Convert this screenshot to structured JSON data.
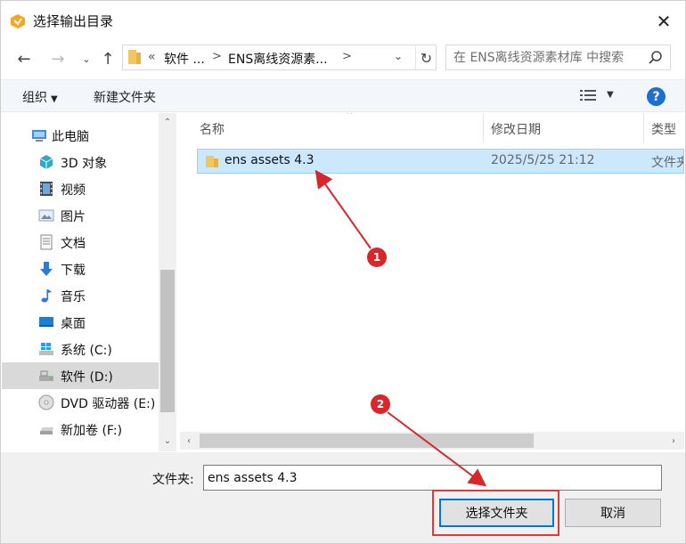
{
  "window": {
    "title": "选择输出目录"
  },
  "address_bar": {
    "segments": [
      "«",
      "软件 ...",
      "ENS离线资源素..."
    ],
    "separators": [
      ">",
      ">"
    ]
  },
  "search": {
    "placeholder": "在 ENS离线资源素材库 中搜索"
  },
  "toolbar": {
    "organize": "组织",
    "new_folder": "新建文件夹"
  },
  "nav_pane": {
    "items": [
      {
        "label": "此电脑",
        "icon": "computer-icon"
      },
      {
        "label": "3D 对象",
        "icon": "cube-3d-icon"
      },
      {
        "label": "视频",
        "icon": "film-icon"
      },
      {
        "label": "图片",
        "icon": "picture-icon"
      },
      {
        "label": "文档",
        "icon": "document-icon"
      },
      {
        "label": "下载",
        "icon": "download-arrow-icon"
      },
      {
        "label": "音乐",
        "icon": "music-note-icon"
      },
      {
        "label": "桌面",
        "icon": "desktop-icon"
      },
      {
        "label": "系统 (C:)",
        "icon": "windows-drive-icon"
      },
      {
        "label": "软件 (D:)",
        "icon": "drive-icon"
      },
      {
        "label": "DVD 驱动器 (E:)",
        "icon": "dvd-icon"
      },
      {
        "label": "新加卷 (F:)",
        "icon": "drive-icon"
      }
    ],
    "selected_index": 9
  },
  "file_list": {
    "columns": [
      "名称",
      "修改日期",
      "类型"
    ],
    "rows": [
      {
        "name": "ens assets 4.3",
        "modified": "2025/5/25 21:12",
        "type": "文件夹"
      }
    ]
  },
  "bottom": {
    "folder_label": "文件夹:",
    "folder_value": "ens assets 4.3",
    "select_button": "选择文件夹",
    "cancel_button": "取消"
  },
  "annotations": {
    "step1": "1",
    "step2": "2"
  },
  "colors": {
    "accent": "#0078d7",
    "selection": "#cce8ff",
    "annotation": "#d9262b"
  }
}
